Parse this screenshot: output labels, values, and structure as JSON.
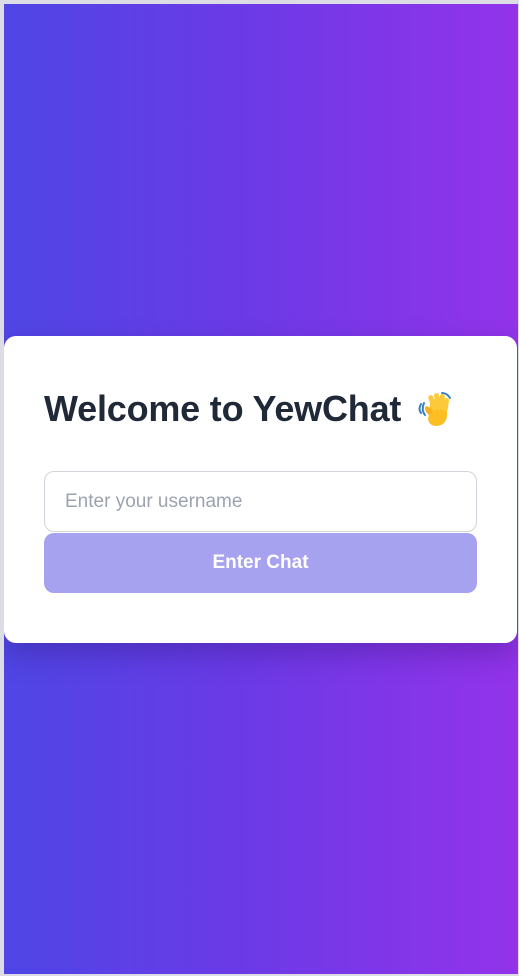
{
  "login": {
    "title": "Welcome to YewChat",
    "title_icon": "waving-hand-icon",
    "username": {
      "value": "",
      "placeholder": "Enter your username"
    },
    "submit_label": "Enter Chat"
  },
  "colors": {
    "gradient_start": "#4f46e5",
    "gradient_end": "#9333ea",
    "button_disabled": "#a7a2f0",
    "title_text": "#1f2937"
  }
}
